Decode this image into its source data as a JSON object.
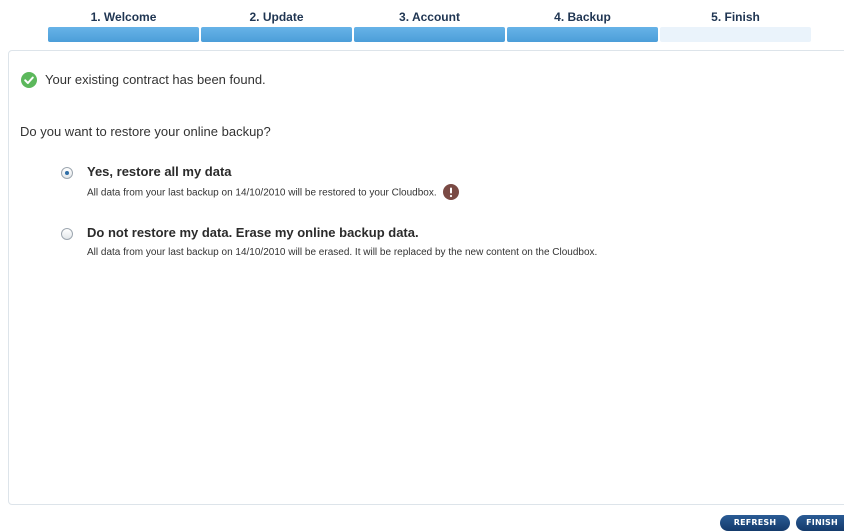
{
  "steps": [
    {
      "label": "1. Welcome",
      "state": "complete"
    },
    {
      "label": "2. Update",
      "state": "complete"
    },
    {
      "label": "3. Account",
      "state": "complete"
    },
    {
      "label": "4. Backup",
      "state": "complete"
    },
    {
      "label": "5. Finish",
      "state": "pending"
    }
  ],
  "status": {
    "icon": "check-circle-icon",
    "message": "Your existing contract has been found."
  },
  "restore": {
    "question": "Do you want to restore your online backup?",
    "options": [
      {
        "title": "Yes, restore all my data",
        "description": "All data from your last backup on 14/10/2010 will be restored to your Cloudbox.",
        "selected": true,
        "info_icon": "alert-icon"
      },
      {
        "title": "Do not restore my data. Erase my online backup data.",
        "description": "All data from your last backup on 14/10/2010 will be erased. It will be replaced by the new content on the Cloudbox.",
        "selected": false
      }
    ]
  },
  "buttons": {
    "refresh_label": "REFRESH",
    "finish_label": "FINISH"
  },
  "colors": {
    "step_complete": "#4c9ed9",
    "step_pending": "#eaf3fb",
    "success": "#5cb85c",
    "button": "#1b447a",
    "alert": "#7a4a44"
  }
}
